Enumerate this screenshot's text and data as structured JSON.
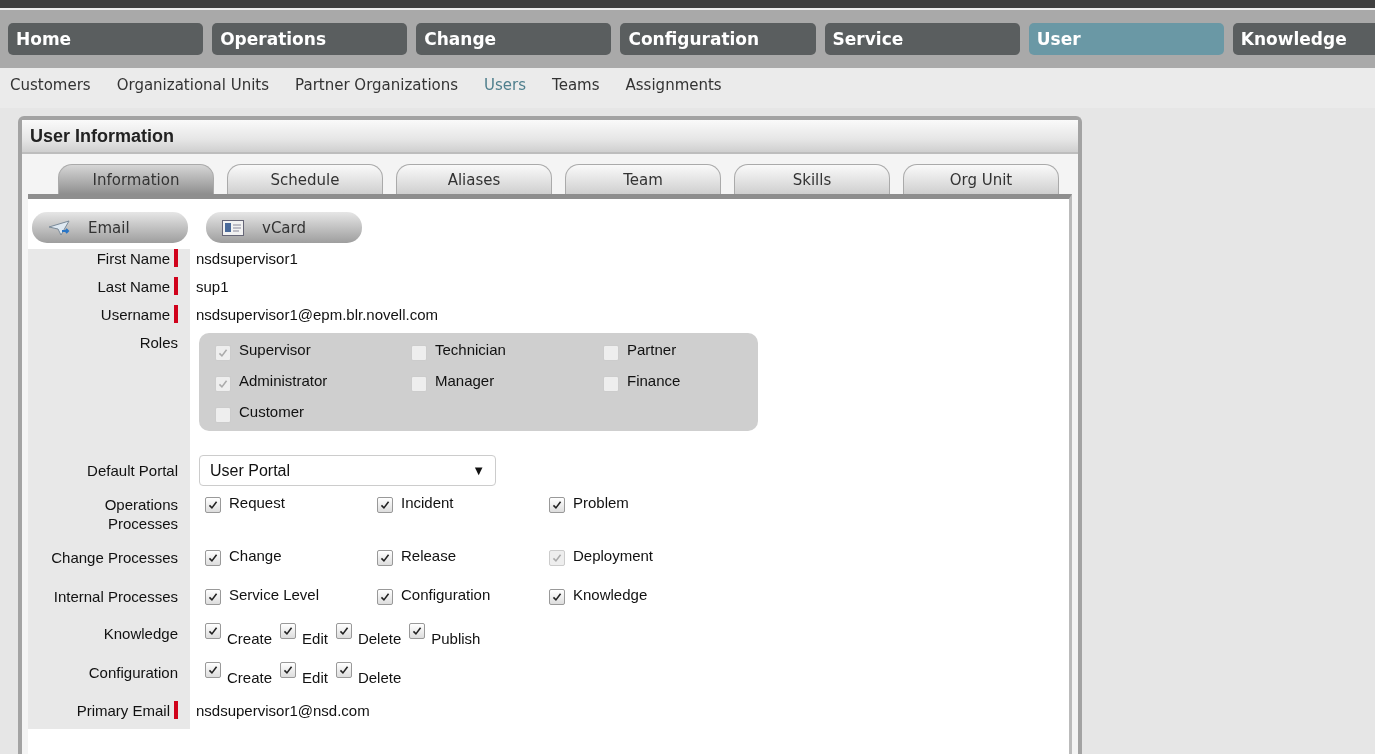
{
  "main_nav": [
    {
      "label": "Home",
      "selected": false
    },
    {
      "label": "Operations",
      "selected": false
    },
    {
      "label": "Change",
      "selected": false
    },
    {
      "label": "Configuration",
      "selected": false
    },
    {
      "label": "Service",
      "selected": false
    },
    {
      "label": "User",
      "selected": true
    },
    {
      "label": "Knowledge",
      "selected": false
    }
  ],
  "sub_nav": [
    {
      "label": "Customers",
      "selected": false
    },
    {
      "label": "Organizational Units",
      "selected": false
    },
    {
      "label": "Partner Organizations",
      "selected": false
    },
    {
      "label": "Users",
      "selected": true
    },
    {
      "label": "Teams",
      "selected": false
    },
    {
      "label": "Assignments",
      "selected": false
    }
  ],
  "panel": {
    "title": "User Information",
    "tabs": [
      {
        "label": "Information",
        "selected": true
      },
      {
        "label": "Schedule",
        "selected": false
      },
      {
        "label": "Aliases",
        "selected": false
      },
      {
        "label": "Team",
        "selected": false
      },
      {
        "label": "Skills",
        "selected": false
      },
      {
        "label": "Org Unit",
        "selected": false
      }
    ],
    "actions": [
      {
        "label": "Email",
        "kind": "email"
      },
      {
        "label": "vCard",
        "kind": "vcard"
      }
    ],
    "fields": [
      {
        "kind": "text",
        "label": "First Name",
        "required": true,
        "value": "nsdsupervisor1"
      },
      {
        "kind": "text",
        "label": "Last Name",
        "required": true,
        "value": "sup1"
      },
      {
        "kind": "text",
        "label": "Username",
        "required": true,
        "value": "nsdsupervisor1@epm.blr.novell.com"
      },
      {
        "kind": "roles",
        "label": "Roles",
        "options": [
          {
            "label": "Supervisor",
            "checked": true,
            "disabled": true
          },
          {
            "label": "Technician",
            "checked": false,
            "disabled": true
          },
          {
            "label": "Partner",
            "checked": false,
            "disabled": true
          },
          {
            "label": "Administrator",
            "checked": true,
            "disabled": true
          },
          {
            "label": "Manager",
            "checked": false,
            "disabled": true
          },
          {
            "label": "Finance",
            "checked": false,
            "disabled": true
          },
          {
            "label": "Customer",
            "checked": false,
            "disabled": true
          }
        ]
      },
      {
        "kind": "select",
        "label": "Default Portal",
        "value": "User Portal",
        "arrow": "▼"
      },
      {
        "kind": "checks",
        "label": "Operations Processes",
        "options": [
          {
            "label": "Request",
            "checked": true,
            "disabled": false
          },
          {
            "label": "Incident",
            "checked": true,
            "disabled": false
          },
          {
            "label": "Problem",
            "checked": true,
            "disabled": false
          }
        ]
      },
      {
        "kind": "checks",
        "label": "Change Processes",
        "options": [
          {
            "label": "Change",
            "checked": true,
            "disabled": false
          },
          {
            "label": "Release",
            "checked": true,
            "disabled": false
          },
          {
            "label": "Deployment",
            "checked": true,
            "disabled": true
          }
        ]
      },
      {
        "kind": "checks",
        "label": "Internal Processes",
        "options": [
          {
            "label": "Service Level",
            "checked": true,
            "disabled": false
          },
          {
            "label": "Configuration",
            "checked": true,
            "disabled": false
          },
          {
            "label": "Knowledge",
            "checked": true,
            "disabled": false
          }
        ]
      },
      {
        "kind": "inline",
        "label": "Knowledge",
        "options": [
          {
            "label": "Create",
            "checked": true,
            "disabled": false
          },
          {
            "label": "Edit",
            "checked": true,
            "disabled": false
          },
          {
            "label": "Delete",
            "checked": true,
            "disabled": false
          },
          {
            "label": "Publish",
            "checked": true,
            "disabled": false
          }
        ]
      },
      {
        "kind": "inline",
        "label": "Configuration",
        "options": [
          {
            "label": "Create",
            "checked": true,
            "disabled": false
          },
          {
            "label": "Edit",
            "checked": true,
            "disabled": false
          },
          {
            "label": "Delete",
            "checked": true,
            "disabled": false
          }
        ]
      },
      {
        "kind": "text",
        "label": "Primary Email",
        "required": true,
        "value": "nsdsupervisor1@nsd.com"
      }
    ]
  }
}
